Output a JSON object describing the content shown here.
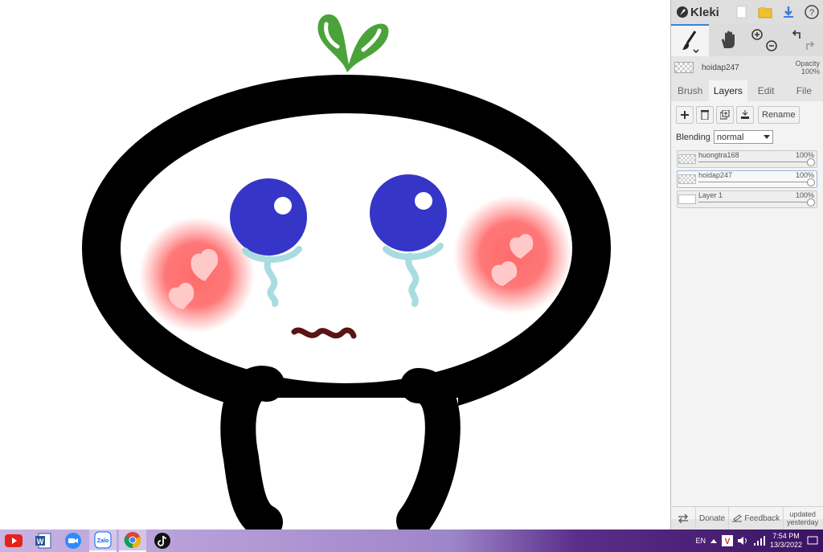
{
  "app": {
    "name": "Kleki",
    "accent": "#3f7de0"
  },
  "current_layer": {
    "name": "hoidap247",
    "opacity_label": "Opacity",
    "opacity_value": "100%"
  },
  "tabs": [
    {
      "label": "Brush",
      "active": false
    },
    {
      "label": "Layers",
      "active": true
    },
    {
      "label": "Edit",
      "active": false
    },
    {
      "label": "File",
      "active": false
    }
  ],
  "layer_actions": {
    "rename_label": "Rename"
  },
  "blending": {
    "label": "Blending",
    "value": "normal"
  },
  "layers": [
    {
      "name": "huongtra168",
      "opacity": "100%"
    },
    {
      "name": "hoidap247",
      "opacity": "100%",
      "selected": true
    },
    {
      "name": "Layer 1",
      "opacity": "100%"
    }
  ],
  "bottom_bar": {
    "donate": "Donate",
    "feedback": "Feedback",
    "updated_line1": "updated",
    "updated_line2": "yesterday"
  },
  "icons": [
    "kleki-logo-icon",
    "new-image-icon",
    "open-folder-icon",
    "download-icon",
    "help-icon",
    "brush-icon",
    "hand-icon",
    "zoom-in-icon",
    "zoom-out-icon",
    "undo-icon",
    "redo-icon",
    "add-layer-icon",
    "delete-layer-icon",
    "duplicate-layer-icon",
    "merge-layer-icon",
    "swap-icon",
    "feedback-icon"
  ],
  "taskbar": {
    "apps": [
      "YouTube",
      "Word",
      "Zoom",
      "Zalo",
      "Chrome",
      "TikTok"
    ],
    "tray": {
      "language": "EN",
      "time": "7:54 PM",
      "date": "13/3/2022"
    }
  },
  "colors": {
    "leaf": "#4aa33a",
    "eye": "#3535c8",
    "blush": "#ff6b6b",
    "tear": "#9fd9de",
    "mouth": "#5a1414"
  }
}
